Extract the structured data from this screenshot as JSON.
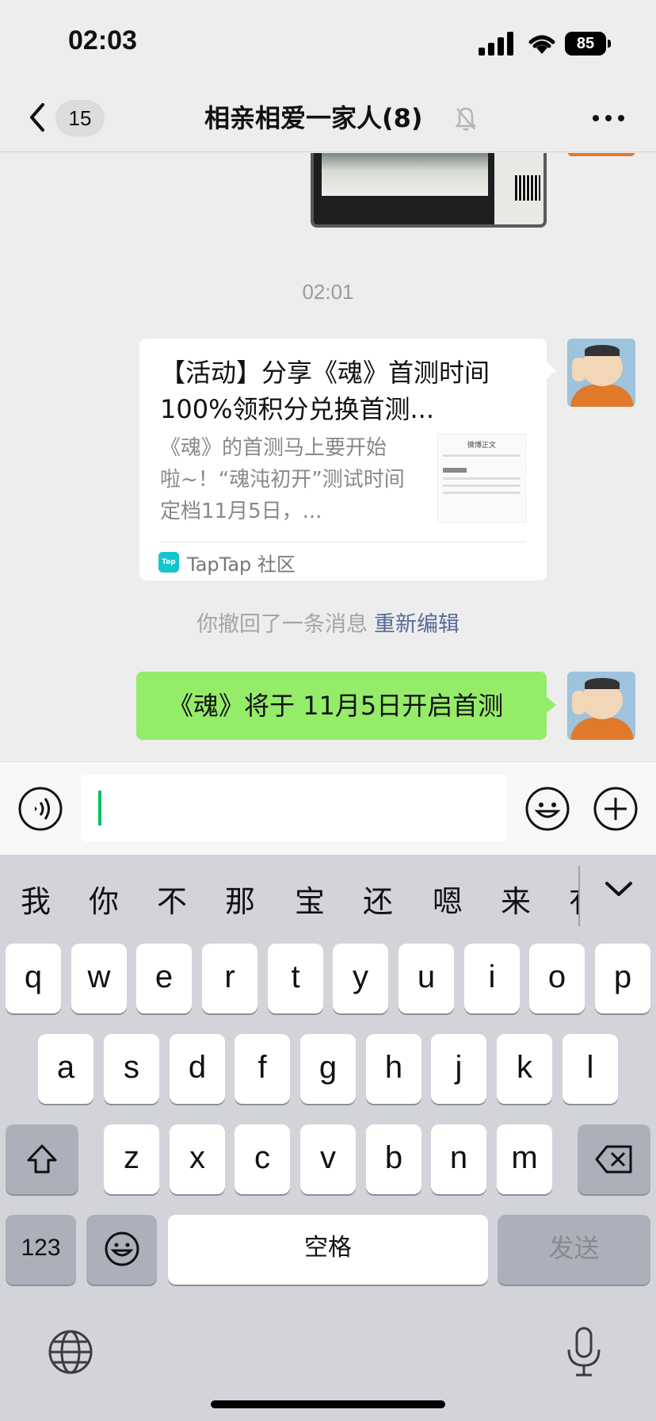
{
  "status_bar": {
    "time": "02:03",
    "battery": "85"
  },
  "header": {
    "back_count": "15",
    "title": "相亲相爱一家人(8)"
  },
  "chat": {
    "timestamp": "02:01",
    "share_card": {
      "title": "【活动】分享《魂》首测时间 100%领积分兑换首测...",
      "description": "《魂》的首测马上要开始啦~！“魂沌初开”测试时间定档11月5日，...",
      "thumb_header": "微博正文",
      "source": "TapTap 社区",
      "source_icon": "Tap"
    },
    "recall_notice": "你撤回了一条消息",
    "recall_edit_label": "重新编辑",
    "message": "《魂》将于 11月5日开启首测"
  },
  "keyboard": {
    "candidates": [
      "我",
      "你",
      "不",
      "那",
      "宝",
      "还",
      "嗯",
      "来",
      "有"
    ],
    "row1": [
      "q",
      "w",
      "e",
      "r",
      "t",
      "y",
      "u",
      "i",
      "o",
      "p"
    ],
    "row2": [
      "a",
      "s",
      "d",
      "f",
      "g",
      "h",
      "j",
      "k",
      "l"
    ],
    "row3": [
      "z",
      "x",
      "c",
      "v",
      "b",
      "n",
      "m"
    ],
    "numbers_label": "123",
    "space_label": "空格",
    "send_label": "发送"
  },
  "colors": {
    "accent_green": "#07c160",
    "bubble_green": "#95ec69",
    "link_blue": "#576b95"
  }
}
